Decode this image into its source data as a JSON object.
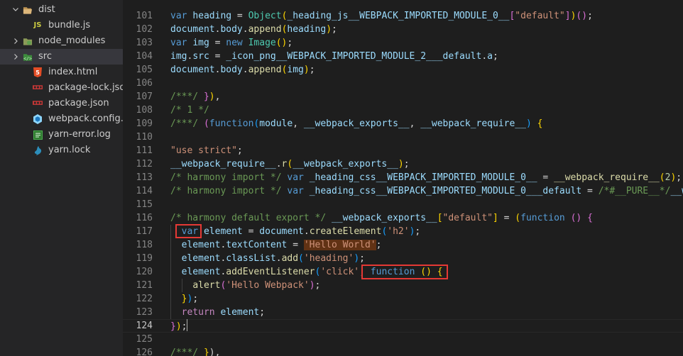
{
  "explorer": {
    "items": [
      {
        "label": "dist",
        "kind": "folder",
        "expanded": true,
        "icon": "folder-open-icon"
      },
      {
        "label": "bundle.js",
        "kind": "file",
        "icon": "js-file-icon",
        "icon_text": "JS"
      },
      {
        "label": "node_modules",
        "kind": "folder",
        "expanded": false,
        "icon": "node-folder-icon"
      },
      {
        "label": "src",
        "kind": "folder",
        "expanded": false,
        "selected": true,
        "icon": "src-folder-icon"
      },
      {
        "label": "index.html",
        "kind": "file",
        "icon": "html-file-icon",
        "icon_text": "5"
      },
      {
        "label": "package-lock.json",
        "kind": "file",
        "icon": "npm-file-icon"
      },
      {
        "label": "package.json",
        "kind": "file",
        "icon": "npm-file-icon"
      },
      {
        "label": "webpack.config.js",
        "kind": "file",
        "icon": "webpack-file-icon"
      },
      {
        "label": "yarn-error.log",
        "kind": "file",
        "icon": "log-file-icon"
      },
      {
        "label": "yarn.lock",
        "kind": "file",
        "icon": "yarn-file-icon"
      }
    ]
  },
  "editor": {
    "active_line": "124",
    "lines": [
      {
        "n": "101",
        "tokens": [
          [
            "kw",
            "var"
          ],
          [
            "pn",
            " "
          ],
          [
            "vr",
            "heading"
          ],
          [
            "pn",
            " = "
          ],
          [
            "ty",
            "Object"
          ],
          [
            "br1",
            "("
          ],
          [
            "vr",
            "_heading_js__WEBPACK_IMPORTED_MODULE_0__"
          ],
          [
            "br2",
            "["
          ],
          [
            "st",
            "\"default\""
          ],
          [
            "br2",
            "]"
          ],
          [
            "br1",
            ")"
          ],
          [
            "br2",
            "()"
          ],
          [
            "pn",
            ";"
          ]
        ]
      },
      {
        "n": "102",
        "tokens": [
          [
            "vr",
            "document"
          ],
          [
            "pn",
            "."
          ],
          [
            "vr",
            "body"
          ],
          [
            "pn",
            "."
          ],
          [
            "fn",
            "append"
          ],
          [
            "br1",
            "("
          ],
          [
            "vr",
            "heading"
          ],
          [
            "br1",
            ")"
          ],
          [
            "pn",
            ";"
          ]
        ]
      },
      {
        "n": "103",
        "tokens": [
          [
            "kw",
            "var"
          ],
          [
            "pn",
            " "
          ],
          [
            "vr",
            "img"
          ],
          [
            "pn",
            " = "
          ],
          [
            "kw",
            "new"
          ],
          [
            "pn",
            " "
          ],
          [
            "ty",
            "Image"
          ],
          [
            "br1",
            "()"
          ],
          [
            "pn",
            ";"
          ]
        ]
      },
      {
        "n": "104",
        "tokens": [
          [
            "vr",
            "img"
          ],
          [
            "pn",
            "."
          ],
          [
            "vr",
            "src"
          ],
          [
            "pn",
            " = "
          ],
          [
            "vr",
            "_icon_png__WEBPACK_IMPORTED_MODULE_2___default"
          ],
          [
            "pn",
            "."
          ],
          [
            "vr",
            "a"
          ],
          [
            "pn",
            ";"
          ]
        ]
      },
      {
        "n": "105",
        "tokens": [
          [
            "vr",
            "document"
          ],
          [
            "pn",
            "."
          ],
          [
            "vr",
            "body"
          ],
          [
            "pn",
            "."
          ],
          [
            "fn",
            "append"
          ],
          [
            "br1",
            "("
          ],
          [
            "vr",
            "img"
          ],
          [
            "br1",
            ")"
          ],
          [
            "pn",
            ";"
          ]
        ]
      },
      {
        "n": "106",
        "tokens": []
      },
      {
        "n": "107",
        "tokens": [
          [
            "cm",
            "/***/ "
          ],
          [
            "br2",
            "}"
          ],
          [
            "br1",
            ")"
          ],
          [
            "pn",
            ","
          ]
        ]
      },
      {
        "n": "108",
        "tokens": [
          [
            "cm",
            "/* 1 */"
          ]
        ]
      },
      {
        "n": "109",
        "tokens": [
          [
            "cm",
            "/***/ "
          ],
          [
            "br2",
            "("
          ],
          [
            "kw",
            "function"
          ],
          [
            "br3",
            "("
          ],
          [
            "vr",
            "module"
          ],
          [
            "pn",
            ", "
          ],
          [
            "vr",
            "__webpack_exports__"
          ],
          [
            "pn",
            ", "
          ],
          [
            "vr",
            "__webpack_require__"
          ],
          [
            "br3",
            ")"
          ],
          [
            "pn",
            " "
          ],
          [
            "br1",
            "{"
          ]
        ]
      },
      {
        "n": "110",
        "tokens": []
      },
      {
        "n": "111",
        "tokens": [
          [
            "st",
            "\"use strict\""
          ],
          [
            "pn",
            ";"
          ]
        ]
      },
      {
        "n": "112",
        "tokens": [
          [
            "vr",
            "__webpack_require__"
          ],
          [
            "pn",
            "."
          ],
          [
            "fn",
            "r"
          ],
          [
            "br1",
            "("
          ],
          [
            "vr",
            "__webpack_exports__"
          ],
          [
            "br1",
            ")"
          ],
          [
            "pn",
            ";"
          ]
        ]
      },
      {
        "n": "113",
        "tokens": [
          [
            "cm",
            "/* harmony import */ "
          ],
          [
            "kw",
            "var"
          ],
          [
            "pn",
            " "
          ],
          [
            "vr",
            "_heading_css__WEBPACK_IMPORTED_MODULE_0__"
          ],
          [
            "pn",
            " = "
          ],
          [
            "fn",
            "__webpack_require__"
          ],
          [
            "br1",
            "("
          ],
          [
            "nm",
            "2"
          ],
          [
            "br1",
            ")"
          ],
          [
            "pn",
            ";"
          ]
        ]
      },
      {
        "n": "114",
        "tokens": [
          [
            "cm",
            "/* harmony import */ "
          ],
          [
            "kw",
            "var"
          ],
          [
            "pn",
            " "
          ],
          [
            "vr",
            "_heading_css__WEBPACK_IMPORTED_MODULE_0___default"
          ],
          [
            "pn",
            " = "
          ],
          [
            "cm",
            "/*#__PURE__*/"
          ],
          [
            "vr",
            "__we"
          ]
        ]
      },
      {
        "n": "115",
        "tokens": []
      },
      {
        "n": "116",
        "tokens": [
          [
            "cm",
            "/* harmony default export */ "
          ],
          [
            "vr",
            "__webpack_exports__"
          ],
          [
            "br1",
            "["
          ],
          [
            "st",
            "\"default\""
          ],
          [
            "br1",
            "]"
          ],
          [
            "pn",
            " = "
          ],
          [
            "br1",
            "("
          ],
          [
            "kw",
            "function"
          ],
          [
            "pn",
            " "
          ],
          [
            "br2",
            "()"
          ],
          [
            "pn",
            " "
          ],
          [
            "br2",
            "{"
          ]
        ]
      },
      {
        "n": "117",
        "tokens": [
          [
            "pn",
            "  "
          ],
          [
            "kw",
            "var"
          ],
          [
            "pn",
            " "
          ],
          [
            "vr",
            "element"
          ],
          [
            "pn",
            " = "
          ],
          [
            "vr",
            "document"
          ],
          [
            "pn",
            "."
          ],
          [
            "fn",
            "createElement"
          ],
          [
            "br3",
            "("
          ],
          [
            "st",
            "'h2'"
          ],
          [
            "br3",
            ")"
          ],
          [
            "pn",
            ";"
          ]
        ]
      },
      {
        "n": "118",
        "tokens": [
          [
            "pn",
            "  "
          ],
          [
            "vr",
            "element"
          ],
          [
            "pn",
            "."
          ],
          [
            "vr",
            "textContent"
          ],
          [
            "pn",
            " = "
          ],
          [
            "st hl",
            "'Hello World'"
          ],
          [
            "pn",
            ";"
          ]
        ]
      },
      {
        "n": "119",
        "tokens": [
          [
            "pn",
            "  "
          ],
          [
            "vr",
            "element"
          ],
          [
            "pn",
            "."
          ],
          [
            "vr",
            "classList"
          ],
          [
            "pn",
            "."
          ],
          [
            "fn",
            "add"
          ],
          [
            "br3",
            "("
          ],
          [
            "st",
            "'heading'"
          ],
          [
            "br3",
            ")"
          ],
          [
            "pn",
            ";"
          ]
        ]
      },
      {
        "n": "120",
        "tokens": [
          [
            "pn",
            "  "
          ],
          [
            "vr",
            "element"
          ],
          [
            "pn",
            "."
          ],
          [
            "fn",
            "addEventListener"
          ],
          [
            "br3",
            "("
          ],
          [
            "st",
            "'click'"
          ],
          [
            "pn",
            ", "
          ],
          [
            "kw",
            "function"
          ],
          [
            "pn",
            " "
          ],
          [
            "br1",
            "()"
          ],
          [
            "pn",
            " "
          ],
          [
            "br1",
            "{"
          ]
        ]
      },
      {
        "n": "121",
        "tokens": [
          [
            "pn",
            "    "
          ],
          [
            "fn",
            "alert"
          ],
          [
            "br2",
            "("
          ],
          [
            "st",
            "'Hello Webpack'"
          ],
          [
            "br2",
            ")"
          ],
          [
            "pn",
            ";"
          ]
        ]
      },
      {
        "n": "122",
        "tokens": [
          [
            "pn",
            "  "
          ],
          [
            "br1",
            "}"
          ],
          [
            "br3",
            ")"
          ],
          [
            "pn",
            ";"
          ]
        ]
      },
      {
        "n": "123",
        "tokens": [
          [
            "pn",
            "  "
          ],
          [
            "ctl",
            "return"
          ],
          [
            "pn",
            " "
          ],
          [
            "vr",
            "element"
          ],
          [
            "pn",
            ";"
          ]
        ]
      },
      {
        "n": "124",
        "tokens": [
          [
            "br2",
            "}"
          ],
          [
            "br1",
            ")"
          ],
          [
            "pn",
            ";"
          ]
        ]
      },
      {
        "n": "125",
        "tokens": []
      },
      {
        "n": "126",
        "tokens": [
          [
            "cm",
            "/***/ "
          ],
          [
            "br1",
            "}"
          ],
          [
            "pn",
            "),"
          ]
        ]
      }
    ]
  },
  "colors": {
    "editor_bg": "#1e1e1e",
    "sidebar_bg": "#252526",
    "selected_row": "#37373d",
    "annotation_box": "#e53935"
  }
}
